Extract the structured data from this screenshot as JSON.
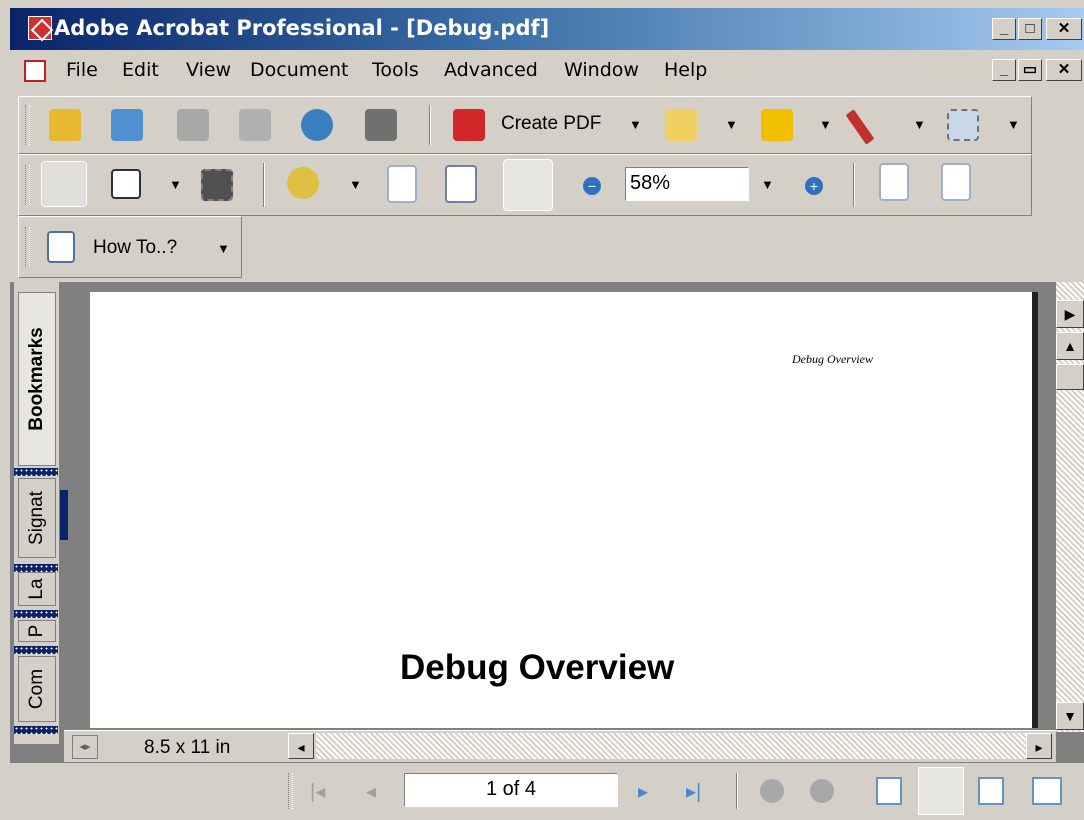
{
  "window": {
    "title": "Adobe Acrobat Professional - [Debug.pdf]"
  },
  "menu": {
    "items": [
      "File",
      "Edit",
      "View",
      "Document",
      "Tools",
      "Advanced",
      "Window",
      "Help"
    ]
  },
  "toolbar1": {
    "create_pdf_label": "Create PDF"
  },
  "toolbar2": {
    "zoom_value": "58%"
  },
  "toolbar3": {
    "howto_label": "How To..?"
  },
  "sidetabs": {
    "bookmarks": "Bookmarks",
    "signatures": "Signat",
    "layers": "La",
    "pages": "P",
    "comments": "Com"
  },
  "document": {
    "header_text": "Debug Overview",
    "heading": "Debug Overview",
    "page_size": "8.5 x 11 in"
  },
  "navigation": {
    "page_indicator": "1 of 4"
  }
}
